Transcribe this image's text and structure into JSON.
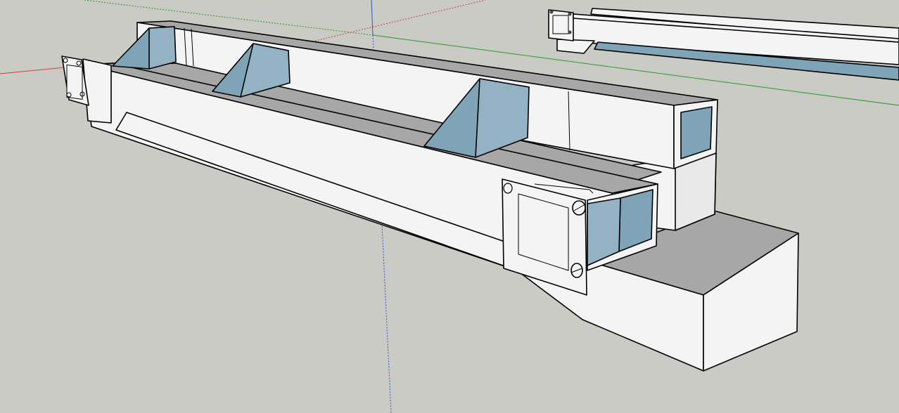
{
  "viewport": {
    "background": "#cbcbc6",
    "face_color": "#f4f4f4",
    "back_face_color": "#7fa4b8",
    "shaded_face_color": "#a7a7a7",
    "edge_color": "#000000"
  },
  "axes": {
    "red_axis_color": "#d04040",
    "green_axis_color": "#2a9a2a",
    "blue_axis_color": "#3050d0"
  }
}
